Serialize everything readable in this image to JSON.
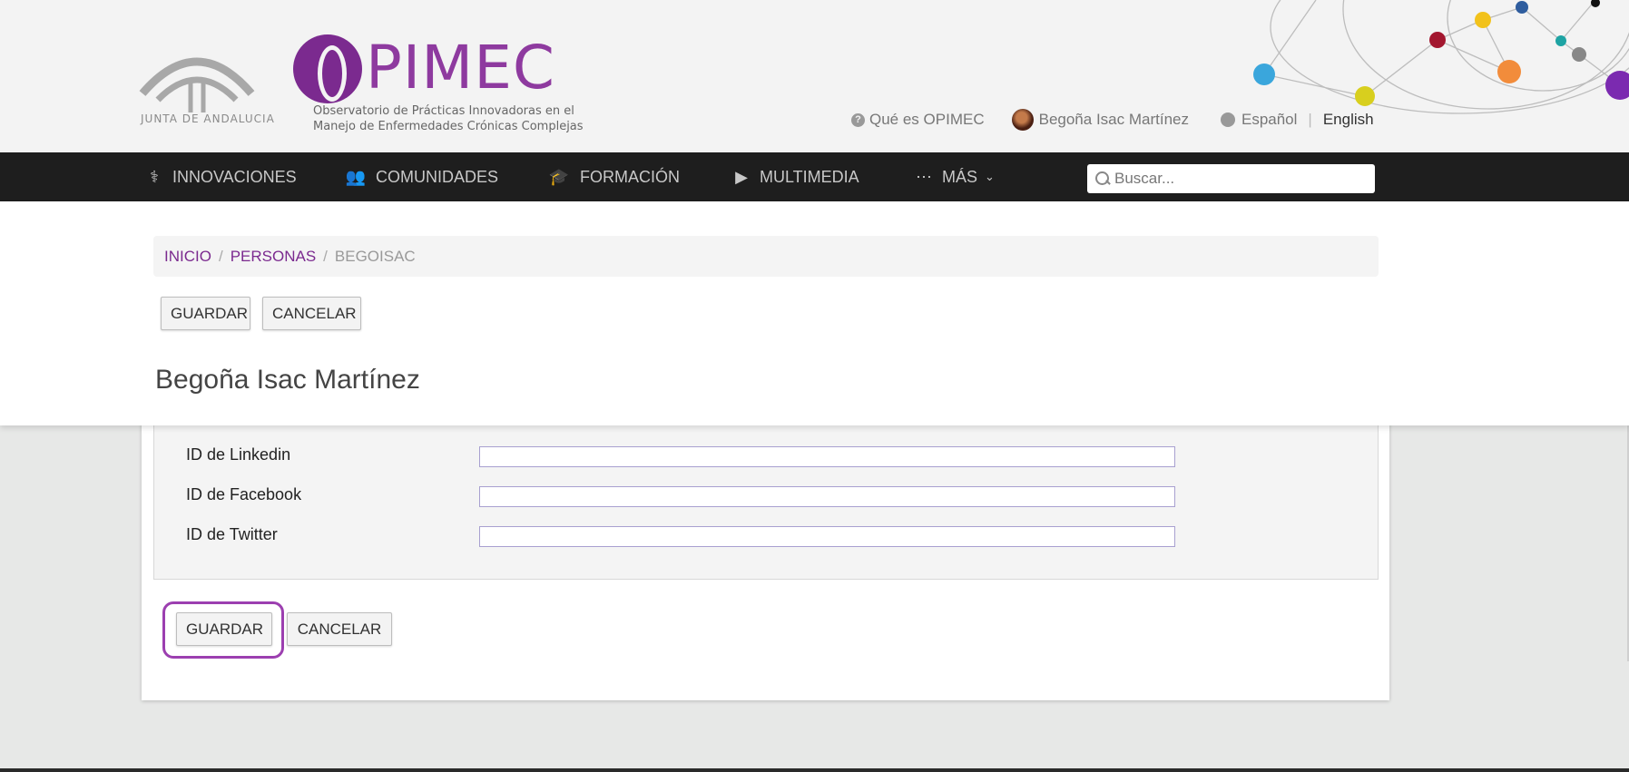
{
  "header": {
    "junta_text": "JUNTA DE ANDALUCIA",
    "brand_word": "PIMEC",
    "brand_sub_line1": "Observatorio de Prácticas Innovadoras en el",
    "brand_sub_line2": "Manejo de Enfermedades Crónicas Complejas",
    "about_link": "Qué es OPIMEC",
    "user_name": "Begoña Isac Martínez",
    "lang_es": "Español",
    "lang_sep": "|",
    "lang_en": "English"
  },
  "nav": {
    "items": [
      {
        "label": "INNOVACIONES",
        "icon": "stethoscope-icon"
      },
      {
        "label": "COMUNIDADES",
        "icon": "users-icon"
      },
      {
        "label": "FORMACIÓN",
        "icon": "graduation-cap-icon"
      },
      {
        "label": "MULTIMEDIA",
        "icon": "play-icon"
      },
      {
        "label": "MÁS",
        "icon": "ellipsis-icon"
      }
    ],
    "search_placeholder": "Buscar..."
  },
  "breadcrumb": {
    "home": "INICIO",
    "people": "PERSONAS",
    "current": "BEGOISAC",
    "sep": "/"
  },
  "actions": {
    "save": "GUARDAR",
    "cancel": "CANCELAR"
  },
  "page_title": "Begoña Isac Martínez",
  "form": {
    "fields": [
      {
        "label": "ID de Linkedin",
        "value": ""
      },
      {
        "label": "ID de Facebook",
        "value": ""
      },
      {
        "label": "ID de Twitter",
        "value": ""
      }
    ]
  },
  "colors": {
    "brand_purple": "#7b2a8f",
    "nav_bg": "#1e1e1e",
    "focus_ring": "#9c3fb0"
  }
}
